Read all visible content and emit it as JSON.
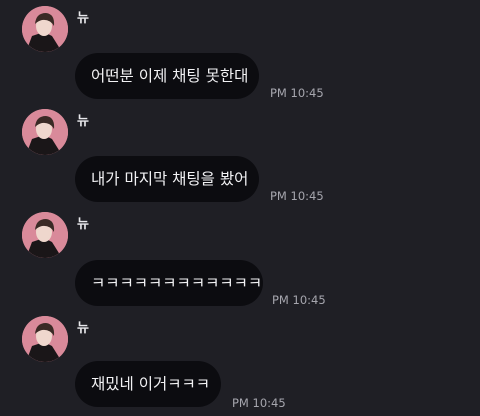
{
  "messages": [
    {
      "sender": "뉴",
      "text": "어떤분 이제 채팅 못한대",
      "time": "PM 10:45"
    },
    {
      "sender": "뉴",
      "text": "내가 마지막 채팅을 봤어",
      "time": "PM 10:45"
    },
    {
      "sender": "뉴",
      "text": "ㅋㅋㅋㅋㅋㅋㅋㅋㅋㅋㅋㅋ",
      "time": "PM 10:45"
    },
    {
      "sender": "뉴",
      "text": "재밌네 이거ㅋㅋㅋ",
      "time": "PM 10:45"
    }
  ],
  "icons": {
    "avatar": "profile-photo-icon"
  },
  "colors": {
    "background": "#1f1f25",
    "bubble": "#0c0c10",
    "text": "#f2f2f4",
    "timestamp": "#a6a6ae",
    "avatar_bg": "#d98a9a"
  }
}
